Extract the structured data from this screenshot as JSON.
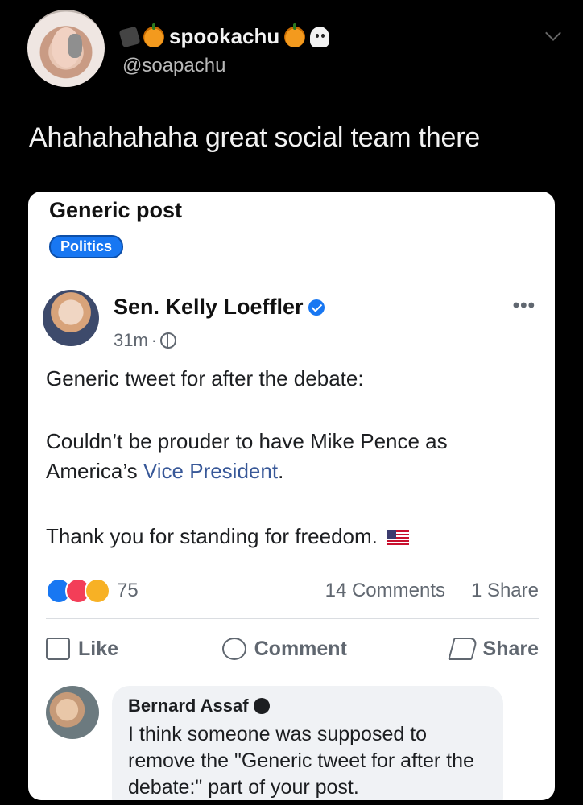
{
  "tweet": {
    "display_name": "spookachu",
    "handle": "@soapachu",
    "text": "Ahahahahaha great social team there"
  },
  "card": {
    "title": "Generic post",
    "tag": "Politics",
    "post": {
      "author": "Sen. Kelly Loeffler",
      "time": "31m",
      "meta_separator": "·",
      "line1": "Generic tweet for after the debate:",
      "line2a": "Couldn’t be prouder to have Mike Pence as America’s ",
      "line2_link": "Vice President",
      "line2b": ".",
      "line3": "Thank you for standing for freedom.",
      "reaction_count": "75",
      "comments_count": "14 Comments",
      "shares_count": "1 Share"
    },
    "actions": {
      "like": "Like",
      "comment": "Comment",
      "share": "Share"
    },
    "comment": {
      "name": "Bernard Assaf",
      "text": "I think someone was supposed to remove the \"Generic tweet for after the debate:\" part of your post."
    }
  },
  "icons": [
    "bat-icon",
    "pumpkin-icon",
    "ghost-icon",
    "chevron-down-icon",
    "verified-icon",
    "globe-icon",
    "more-icon",
    "flag-icon",
    "like-icon",
    "comment-icon",
    "share-icon",
    "government-icon"
  ],
  "colors": {
    "background": "#000000",
    "card": "#ffffff",
    "facebook_blue": "#1877f2",
    "link": "#385898"
  }
}
